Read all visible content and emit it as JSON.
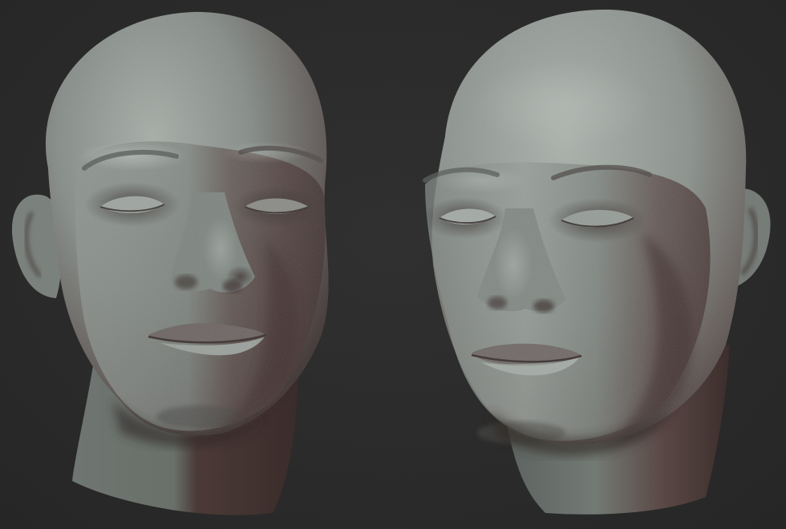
{
  "scene": {
    "background": "#2b2b2b",
    "material": "clay-gray",
    "base_color": "#8a918c",
    "shadow_tint": "#5a3a36",
    "subjects": [
      {
        "name": "head-sculpt-left",
        "view": "three-quarter-left"
      },
      {
        "name": "head-sculpt-right",
        "view": "three-quarter-right"
      }
    ]
  }
}
